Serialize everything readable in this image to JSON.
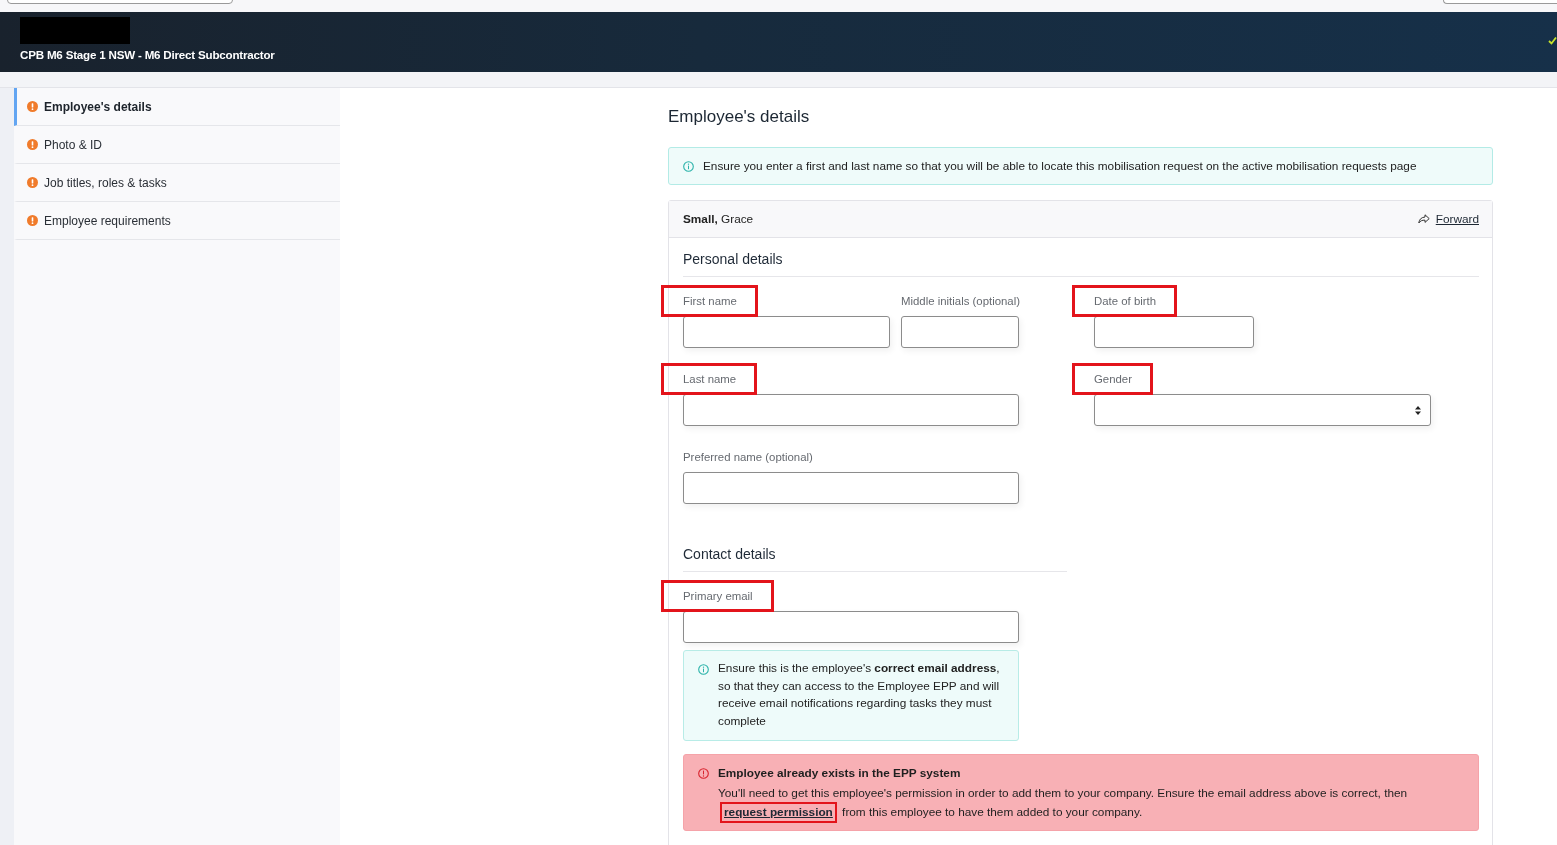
{
  "header": {
    "subtitle": "CPB M6 Stage 1 NSW - M6 Direct Subcontractor"
  },
  "sidebar": {
    "items": [
      {
        "label": "Employee's details",
        "selected": true,
        "incomplete": true
      },
      {
        "label": "Photo & ID",
        "selected": false,
        "incomplete": true
      },
      {
        "label": "Job titles, roles & tasks",
        "selected": false,
        "incomplete": true
      },
      {
        "label": "Employee requirements",
        "selected": false,
        "incomplete": true
      }
    ]
  },
  "page": {
    "title": "Employee's details",
    "notice": "Ensure you enter a first and last name so that you will be able to locate this mobilisation request on the active mobilisation requests page"
  },
  "employee_card": {
    "name": "**Small,** Grace",
    "forward_link": "Forward",
    "personal_details": {
      "heading": "Personal details",
      "fields": [
        {
          "label": "First name",
          "kind": "text",
          "highlighted": true
        },
        {
          "label": "Middle initials (optional)",
          "kind": "text",
          "highlighted": false
        },
        {
          "label": "Date of birth",
          "kind": "date",
          "highlighted": true
        },
        {
          "label": "Last name",
          "kind": "text",
          "highlighted": true
        },
        {
          "label": "Gender",
          "kind": "select",
          "highlighted": true
        },
        {
          "label": "Preferred name (optional)",
          "kind": "text",
          "highlighted": false
        }
      ]
    },
    "contact_details": {
      "heading": "Contact details",
      "fields": [
        {
          "label": "Primary email",
          "kind": "text",
          "highlighted": true
        }
      ],
      "info": "Ensure this is the employee's **correct email address**, so that they can access to the Employee EPP and will receive email notifications regarding tasks they must complete",
      "error": {
        "title": "Employee already exists in the EPP system",
        "text_before": "You'll need to get this employee's permission in order to add them to your company. Ensure the email address above is correct, then",
        "link": {
          "label": "request permission",
          "highlighted": true
        },
        "text_after": "from this employee to have them added to your company."
      }
    }
  }
}
